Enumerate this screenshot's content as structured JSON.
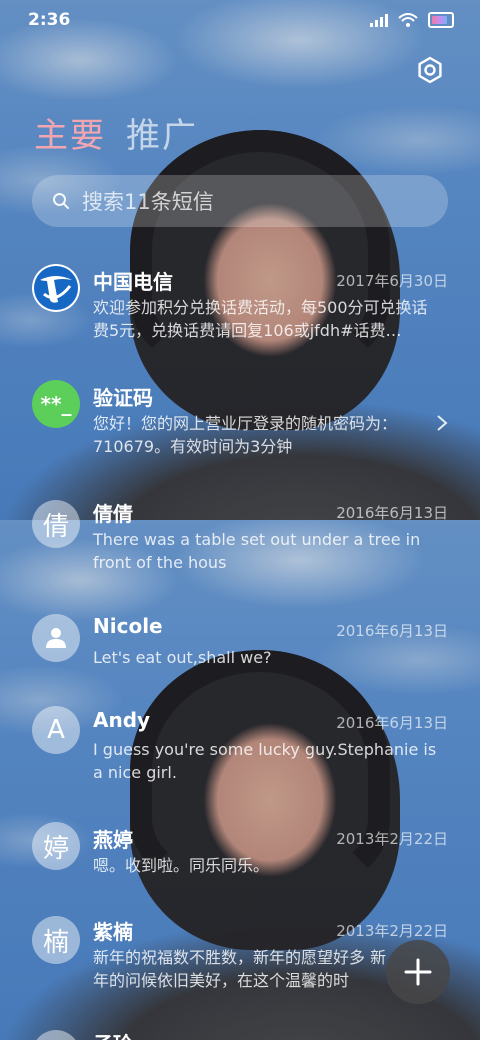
{
  "status": {
    "time": "2:36"
  },
  "tabs": [
    "主要",
    "推广"
  ],
  "search": {
    "placeholder": "搜索11条短信"
  },
  "conversations": [
    {
      "name": "中国电信",
      "date": "2017年6月30日",
      "preview": "欢迎参加积分兑换话费活动，每500分可兑换话费5元，兑换话费请回复106或jfdh#话费…",
      "avatar": "china-telecom-logo"
    },
    {
      "name": "验证码",
      "date": "",
      "preview": "您好！您的网上营业厅登录的随机密码为：710679。有效时间为3分钟",
      "avatar_text": "**_",
      "avatar_color": "#5ccf5a"
    },
    {
      "name": "倩倩",
      "date": "2016年6月13日",
      "preview": "There was a table set out under a tree in front of the hous",
      "avatar_text": "倩"
    },
    {
      "name": "Nicole",
      "date": "2016年6月13日",
      "preview": "Let's eat out,shall we?",
      "avatar": "person-icon"
    },
    {
      "name": "Andy",
      "date": "2016年6月13日",
      "preview": "I guess you're some lucky guy.Stephanie is a nice girl.",
      "avatar_text": "A"
    },
    {
      "name": "燕婷",
      "date": "2013年2月22日",
      "preview": "嗯。收到啦。同乐同乐。",
      "avatar_text": "婷"
    },
    {
      "name": "紫楠",
      "date": "2013年2月22日",
      "preview": "新年的祝福数不胜数，新年的愿望好多 新年的问候依旧美好，在这个温馨的时",
      "avatar_text": "楠"
    },
    {
      "name": "子玲",
      "date": "",
      "preview": "",
      "avatar_text": ""
    }
  ],
  "colors": {
    "active_tab": "#f2a6b2",
    "fab_bg": "#464648"
  }
}
